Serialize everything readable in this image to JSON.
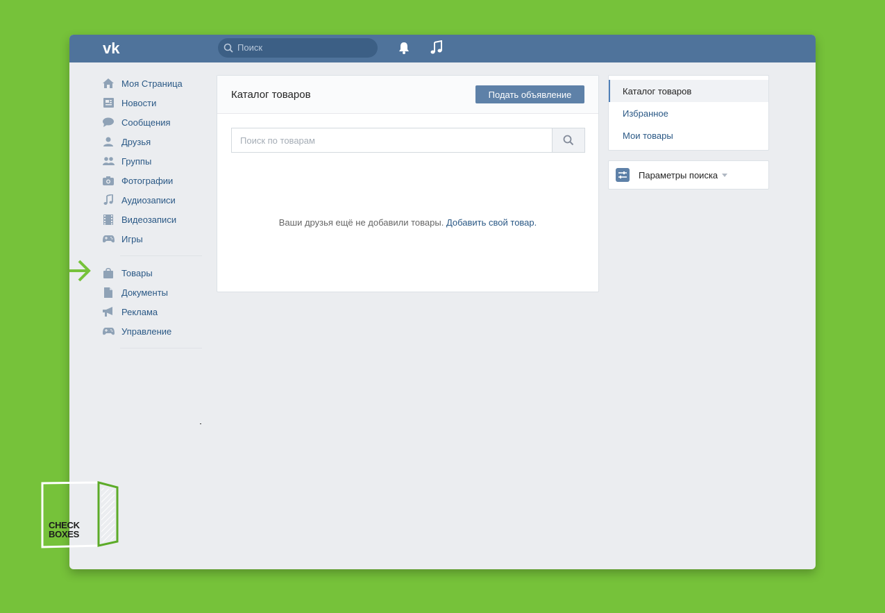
{
  "topbar": {
    "logo": "VK",
    "search_placeholder": "Поиск",
    "icons": [
      "bell-icon",
      "music-note-icon"
    ]
  },
  "sidebar": {
    "items": [
      {
        "label": "Моя Страница",
        "icon": "home-icon"
      },
      {
        "label": "Новости",
        "icon": "news-icon"
      },
      {
        "label": "Сообщения",
        "icon": "chat-icon"
      },
      {
        "label": "Друзья",
        "icon": "person-icon"
      },
      {
        "label": "Группы",
        "icon": "people-icon"
      },
      {
        "label": "Фотографии",
        "icon": "camera-icon"
      },
      {
        "label": "Аудиозаписи",
        "icon": "music-note-icon"
      },
      {
        "label": "Видеозаписи",
        "icon": "film-icon"
      },
      {
        "label": "Игры",
        "icon": "gamepad-icon"
      }
    ],
    "items2": [
      {
        "label": "Товары",
        "icon": "bag-icon"
      },
      {
        "label": "Документы",
        "icon": "document-icon"
      },
      {
        "label": "Реклама",
        "icon": "megaphone-icon"
      },
      {
        "label": "Управление",
        "icon": "gamepad-icon"
      }
    ]
  },
  "main": {
    "title": "Каталог товаров",
    "post_button": "Подать объявление",
    "search_placeholder": "Поиск по товарам",
    "empty_text": "Ваши друзья ещё не добавили товары.",
    "empty_link": "Добавить свой товар."
  },
  "right_menu": {
    "items": [
      "Каталог товаров",
      "Избранное",
      "Мои товары"
    ],
    "active": 0
  },
  "filter": {
    "label": "Параметры поиска"
  },
  "brand": {
    "line1": "CHECK",
    "line2": "BOXES"
  },
  "colors": {
    "background": "#76c23a",
    "header": "#4f739b",
    "accent": "#5e81a8",
    "link": "#2a5885"
  }
}
